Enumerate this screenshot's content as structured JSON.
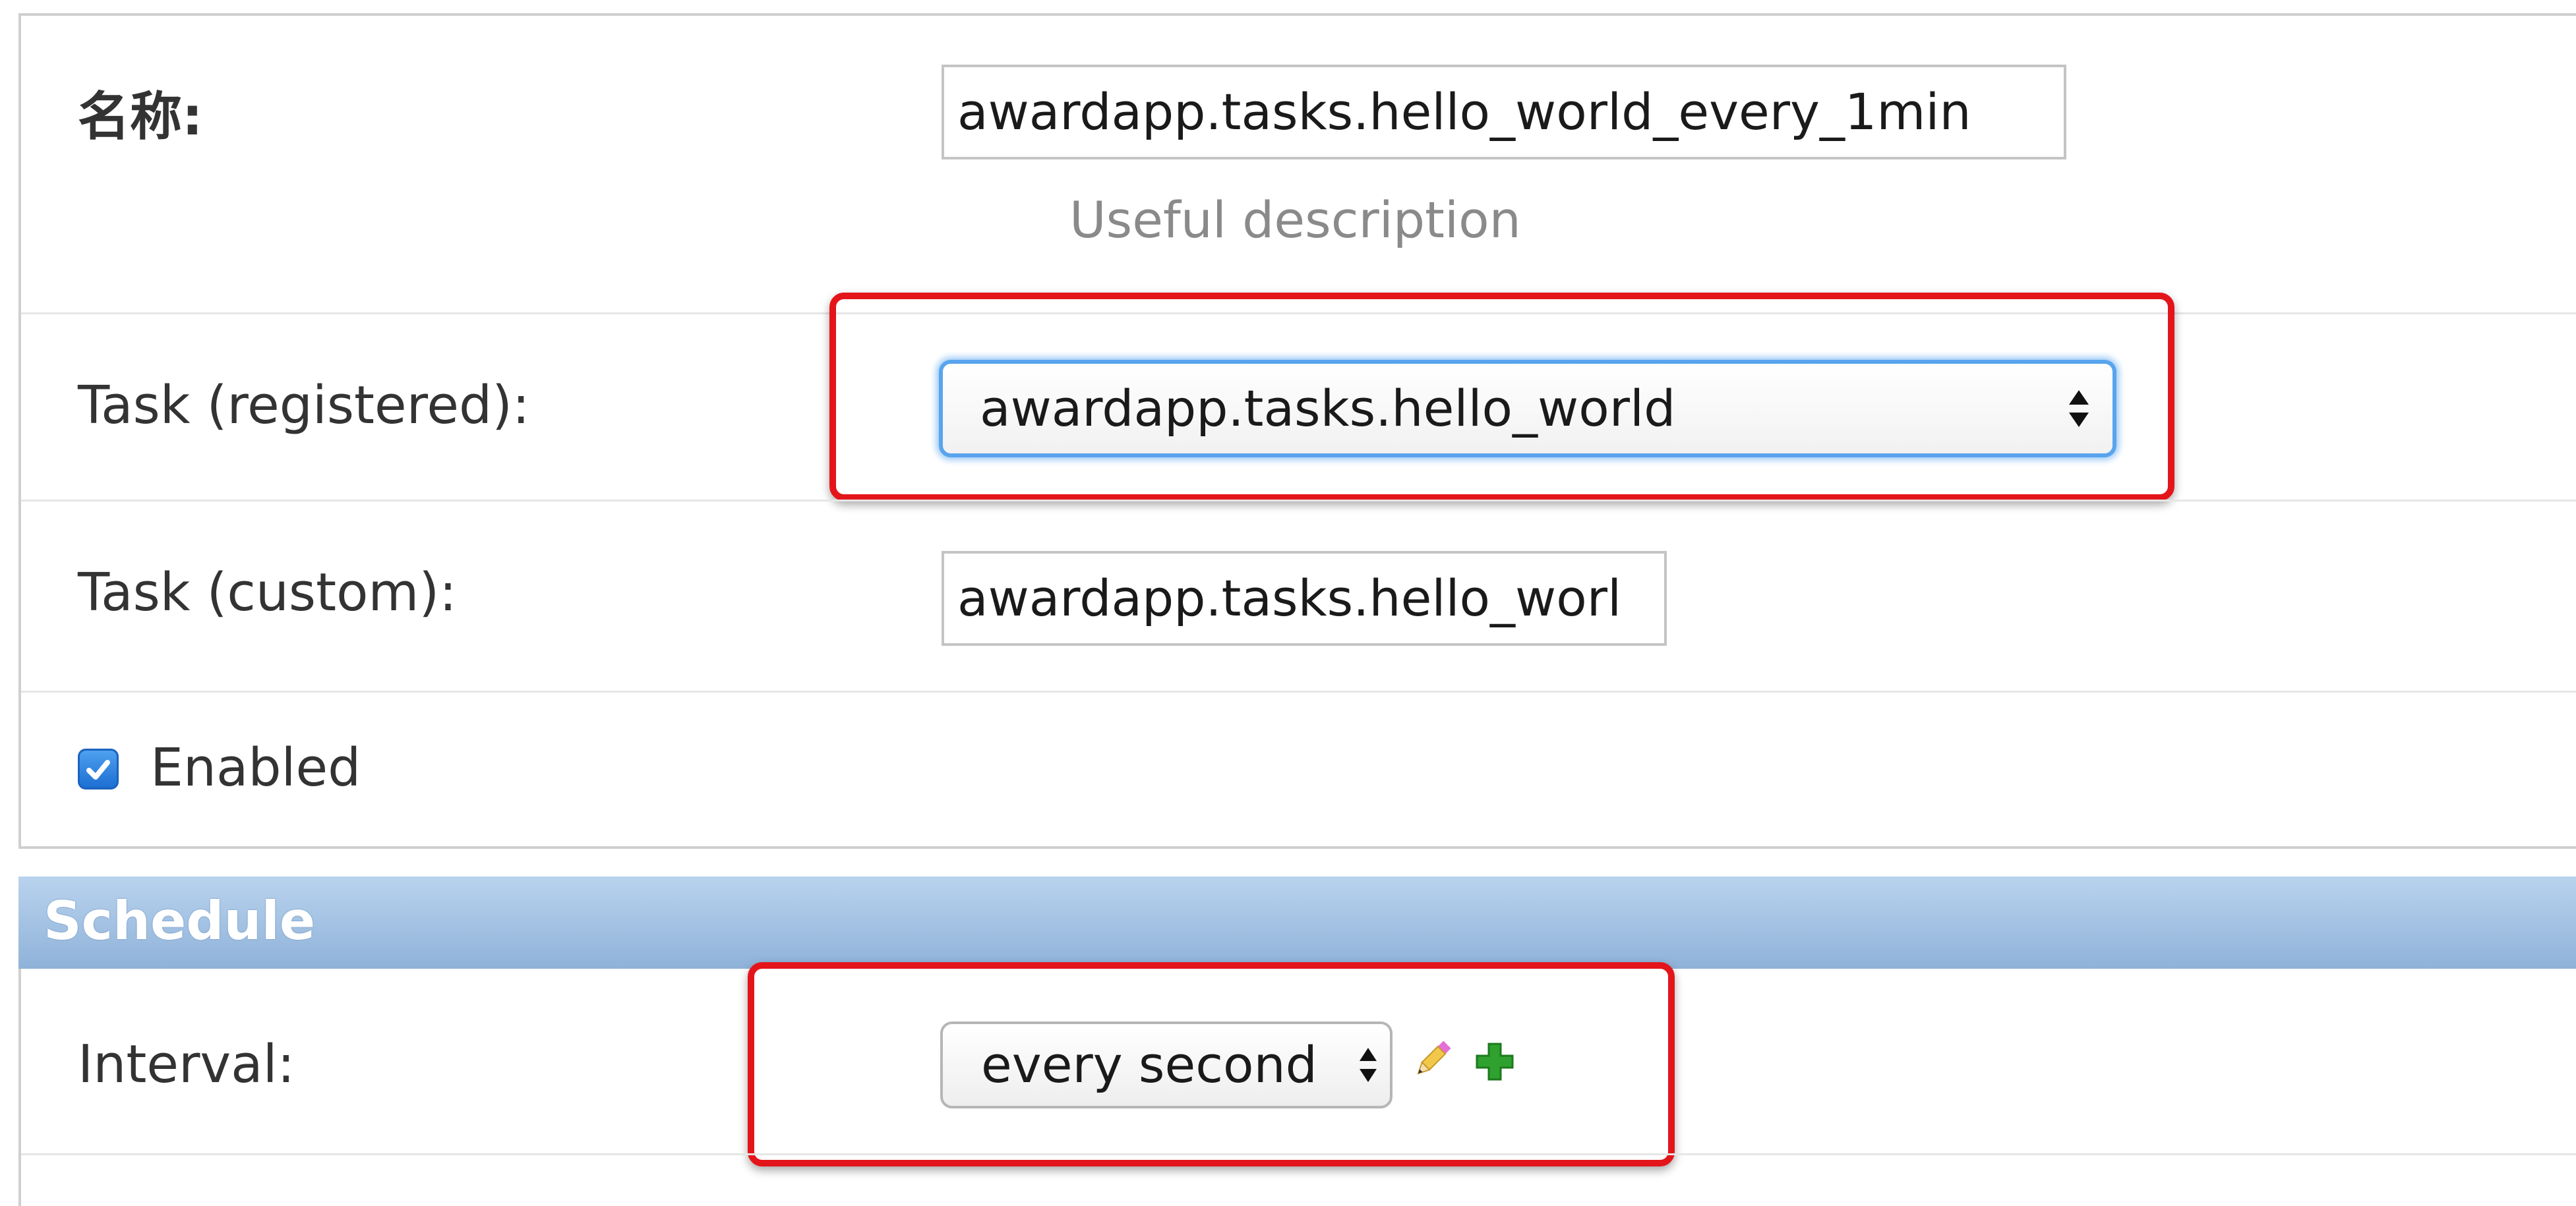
{
  "form": {
    "name": {
      "label": "名称:",
      "value": "awardapp.tasks.hello_world_every_1min",
      "help": "Useful description"
    },
    "task_registered": {
      "label": "Task (registered):",
      "selected": "awardapp.tasks.hello_world"
    },
    "task_custom": {
      "label": "Task (custom):",
      "value": "awardapp.tasks.hello_worl"
    },
    "enabled": {
      "label": "Enabled",
      "checked": true
    }
  },
  "schedule": {
    "title": "Schedule",
    "interval": {
      "label": "Interval:",
      "selected": "every second",
      "edit_icon": "pencil-icon",
      "add_icon": "plus-icon"
    }
  },
  "colors": {
    "highlight": "#e3151b",
    "focus_ring": "#58a4ee",
    "section_header": "#9fbfe0",
    "add_icon": "#2fa12f"
  }
}
